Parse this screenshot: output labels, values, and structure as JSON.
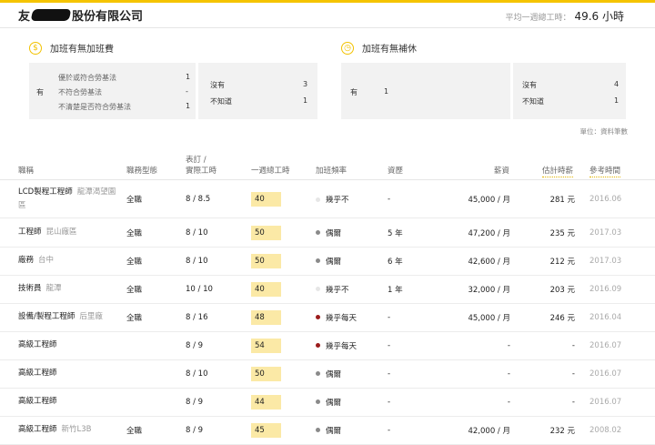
{
  "header": {
    "company_prefix": "友",
    "company_suffix": "股份有限公司",
    "avg_label": "平均一週總工時：",
    "avg_value": "49.6 小時"
  },
  "overtime_pay": {
    "title": "加班有無加班費",
    "icon": "dollar-icon",
    "yes_label": "有",
    "yes_items": [
      {
        "label": "優於或符合勞基法",
        "value": "1"
      },
      {
        "label": "不符合勞基法",
        "value": "-"
      },
      {
        "label": "不清楚是否符合勞基法",
        "value": "1"
      }
    ],
    "other_items": [
      {
        "label": "沒有",
        "value": "3"
      },
      {
        "label": "不知道",
        "value": "1"
      }
    ]
  },
  "comp_leave": {
    "title": "加班有無補休",
    "icon": "clock-icon",
    "yes_label": "有",
    "yes_value": "1",
    "other_items": [
      {
        "label": "沒有",
        "value": "4"
      },
      {
        "label": "不知道",
        "value": "1"
      }
    ]
  },
  "unit_note": "單位：資料筆數",
  "table": {
    "headers": {
      "title": "職稱",
      "type": "職務型態",
      "hours_line1": "表訂 /",
      "hours_line2": "實際工時",
      "weekly": "一週總工時",
      "freq": "加班頻率",
      "exp": "資歷",
      "salary": "薪資",
      "hourly": "估計時薪",
      "ref": "參考時間"
    },
    "rows": [
      {
        "title": "LCD製程工程師",
        "loc": "龍潭渴望園區",
        "type": "全職",
        "hours": "8 / 8.5",
        "weekly": "40",
        "freq": "幾乎不",
        "freq_color": "#e6e6e6",
        "exp": "-",
        "salary": "45,000 / 月",
        "hourly": "281 元",
        "date": "2016.06"
      },
      {
        "title": "工程師",
        "loc": "昆山廠區",
        "type": "全職",
        "hours": "8 / 10",
        "weekly": "50",
        "freq": "偶爾",
        "freq_color": "#8a8a8a",
        "exp": "5 年",
        "salary": "47,200 / 月",
        "hourly": "235 元",
        "date": "2017.03"
      },
      {
        "title": "廠務",
        "loc": "台中",
        "type": "全職",
        "hours": "8 / 10",
        "weekly": "50",
        "freq": "偶爾",
        "freq_color": "#8a8a8a",
        "exp": "6 年",
        "salary": "42,600 / 月",
        "hourly": "212 元",
        "date": "2017.03"
      },
      {
        "title": "技術員",
        "loc": "龍潭",
        "type": "全職",
        "hours": "10 / 10",
        "weekly": "40",
        "freq": "幾乎不",
        "freq_color": "#e6e6e6",
        "exp": "1 年",
        "salary": "32,000 / 月",
        "hourly": "203 元",
        "date": "2016.09"
      },
      {
        "title": "設備/製程工程師",
        "loc": "后里廠",
        "type": "全職",
        "hours": "8 / 16",
        "weekly": "48",
        "freq": "幾乎每天",
        "freq_color": "#9b1c1c",
        "exp": "-",
        "salary": "45,000 / 月",
        "hourly": "246 元",
        "date": "2016.04"
      },
      {
        "title": "高級工程師",
        "loc": "",
        "type": "",
        "hours": "8 / 9",
        "weekly": "54",
        "freq": "幾乎每天",
        "freq_color": "#9b1c1c",
        "exp": "-",
        "salary": "-",
        "hourly": "-",
        "date": "2016.07"
      },
      {
        "title": "高級工程師",
        "loc": "",
        "type": "",
        "hours": "8 / 10",
        "weekly": "50",
        "freq": "偶爾",
        "freq_color": "#8a8a8a",
        "exp": "-",
        "salary": "-",
        "hourly": "-",
        "date": "2016.07"
      },
      {
        "title": "高級工程師",
        "loc": "",
        "type": "",
        "hours": "8 / 9",
        "weekly": "44",
        "freq": "偶爾",
        "freq_color": "#8a8a8a",
        "exp": "-",
        "salary": "-",
        "hourly": "-",
        "date": "2016.07"
      },
      {
        "title": "高級工程師",
        "loc": "新竹L3B",
        "type": "全職",
        "hours": "8 / 9",
        "weekly": "45",
        "freq": "偶爾",
        "freq_color": "#8a8a8a",
        "exp": "-",
        "salary": "42,000 / 月",
        "hourly": "232 元",
        "date": "2008.02"
      }
    ]
  }
}
